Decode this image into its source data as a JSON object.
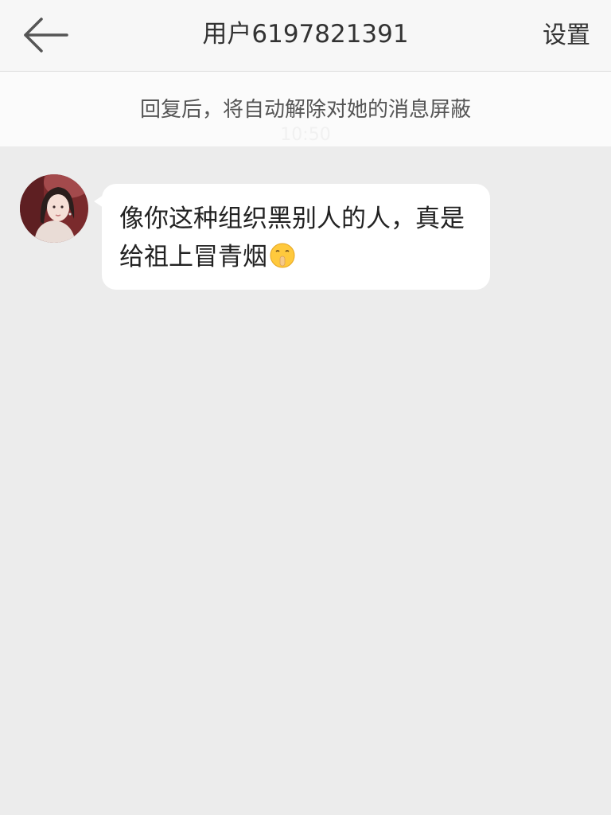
{
  "header": {
    "title": "用户6197821391",
    "settings_label": "设置",
    "back_icon": "back-arrow-icon"
  },
  "notice": {
    "text": "回复后，将自动解除对她的消息屏蔽"
  },
  "timestamp": "10:50",
  "messages": [
    {
      "sender": "other",
      "text": "像你这种组织黑别人的人，真是给祖上冒青烟",
      "emoji": "shushing-face-emoji"
    }
  ],
  "colors": {
    "header_bg": "#f7f7f7",
    "notice_bg": "#fbfbfb",
    "chat_bg": "#ececec",
    "bubble_bg": "#ffffff",
    "text": "#333333"
  }
}
